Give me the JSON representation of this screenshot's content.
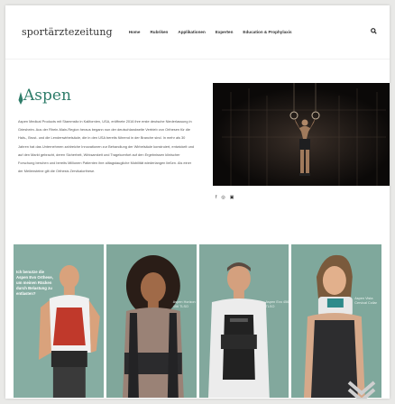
{
  "header": {
    "logo": "sportärztezeitung",
    "nav": [
      "Home",
      "Rubriken",
      "Applikationen",
      "Experten",
      "Education & Prophylaxis"
    ],
    "search_icon": "search-icon"
  },
  "brand": {
    "name": "Aspen",
    "article": "Aspen Medical Products mit Stammsitz in Kalifornien, USA, eröffnete 2016 ihre erste deutsche Niederlassung in Griesheim. Aus der Rhein-Main-Region heraus begann nun der deutschlandweite Vertrieb von Orthesen für die Hals-, Brust- und die Lendenwirbelsäule, die in den USA bereits führend in der Branche sind. In mehr als 30 Jahren hat das Unternehmen zahlreiche Innovationen zur Behandlung der Wirbelsäule konstruiert, entwickelt und auf den Markt gebracht, deren Sicherheit, Wirksamkeit und Tragekomfort auf den Ergebnissen klinischer Forschung beruhen und bereits Millionen Patienten ihre alltagstaugliche Mobilität wiederlangen ließen. Als einer der Meilensteine gilt die Orthesis Zervikalorthese."
  },
  "social": [
    "f",
    "◎",
    "▣"
  ],
  "panels": [
    {
      "text": "Ich benutze die Aspen Evo Orthese, um meinen Rücken durch Belastung zu entlasten?"
    },
    {
      "label": "Aspen Horizon 456 TLSO"
    },
    {
      "label": "Aspen Evo 456 TLSO"
    },
    {
      "label": "Aspen Vista Cervical Collar"
    }
  ],
  "colors": {
    "brand_green": "#2f7d6a",
    "panel_green": "#7fa79c"
  }
}
